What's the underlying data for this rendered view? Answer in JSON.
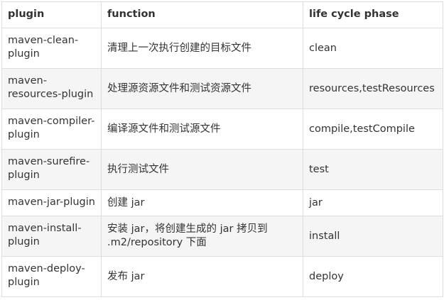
{
  "table": {
    "headers": [
      "plugin",
      "function",
      "life cycle phase"
    ],
    "rows": [
      {
        "plugin": "maven-clean-plugin",
        "function": "清理上一次执行创建的目标文件",
        "phase": "clean"
      },
      {
        "plugin": "maven-resources-plugin",
        "function": "处理源资源文件和测试资源文件",
        "phase": "resources,testResources"
      },
      {
        "plugin": "maven-compiler-plugin",
        "function": "编译源文件和测试源文件",
        "phase": "compile,testCompile"
      },
      {
        "plugin": "maven-surefire-plugin",
        "function": "执行测试文件",
        "phase": "test"
      },
      {
        "plugin": "maven-jar-plugin",
        "function": "创建 jar",
        "phase": "jar"
      },
      {
        "plugin": "maven-install-plugin",
        "function": "安装 jar，将创建生成的 jar 拷贝到 .m2/repository 下面",
        "phase": "install"
      },
      {
        "plugin": "maven-deploy-plugin",
        "function": "发布 jar",
        "phase": "deploy"
      }
    ]
  }
}
